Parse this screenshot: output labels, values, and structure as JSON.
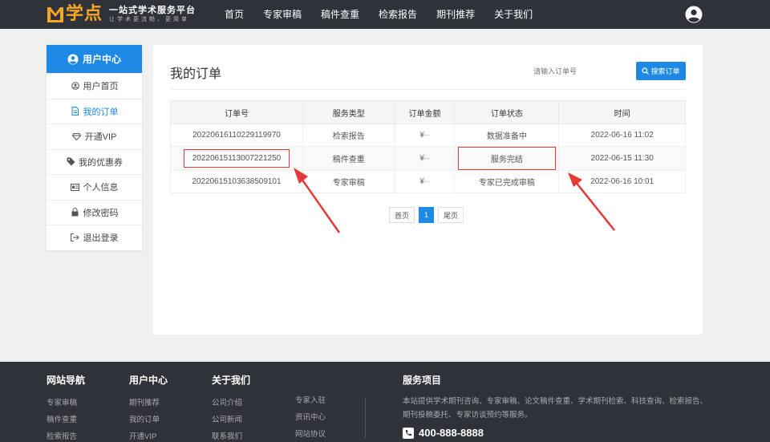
{
  "brand": {
    "logo_text": "学点",
    "tagline": "一站式学术服务平台",
    "tagline_sub": "让学术更流畅、更简单"
  },
  "nav": {
    "items": [
      {
        "label": "首页"
      },
      {
        "label": "专家审稿"
      },
      {
        "label": "稿件查重"
      },
      {
        "label": "检索报告"
      },
      {
        "label": "期刊推荐"
      },
      {
        "label": "关于我们"
      }
    ]
  },
  "sidebar": {
    "header": "用户中心",
    "items": [
      {
        "label": "用户首页",
        "icon": "user-circle-icon"
      },
      {
        "label": "我的订单",
        "icon": "document-icon",
        "active": true
      },
      {
        "label": "开通VIP",
        "icon": "diamond-icon"
      },
      {
        "label": "我的优惠券",
        "icon": "tag-icon"
      },
      {
        "label": "个人信息",
        "icon": "id-card-icon"
      },
      {
        "label": "修改密码",
        "icon": "lock-icon"
      },
      {
        "label": "退出登录",
        "icon": "logout-icon"
      }
    ]
  },
  "main": {
    "title": "我的订单",
    "search_placeholder": "请输入订单号",
    "search_button": "搜索订单",
    "table": {
      "headers": [
        "订单号",
        "服务类型",
        "订单金额",
        "订单状态",
        "时间"
      ],
      "rows": [
        {
          "id": "20220616110229119970",
          "type": "检索报告",
          "amount": "¥··",
          "status": "数据准备中",
          "status_color": "#8e44ad",
          "time": "2022-06-16 11:02"
        },
        {
          "id": "20220615113007221250",
          "type": "稿件查重",
          "amount": "¥··",
          "status": "服务完结",
          "status_color": "#5cb85c",
          "time": "2022-06-15 11:30"
        },
        {
          "id": "20220615103638509101",
          "type": "专家审稿",
          "amount": "¥··",
          "status": "专家已完成审稿",
          "status_color": "#5cb85c",
          "time": "2022-06-16 10:01"
        }
      ]
    },
    "pager": {
      "first": "首页",
      "current": "1",
      "last": "尾页"
    }
  },
  "footer": {
    "col1": {
      "title": "网站导航",
      "links": [
        "专家审稿",
        "稿件查重",
        "检索报告"
      ]
    },
    "col2": {
      "title": "用户中心",
      "links": [
        "期刊推荐",
        "我的订单",
        "开通VIP"
      ]
    },
    "col3": {
      "title": "关于我们",
      "links": [
        "公司介绍",
        "公司新闻",
        "联系我们"
      ]
    },
    "col4": {
      "links": [
        "专家入驻",
        "资讯中心",
        "网站协议"
      ]
    },
    "services": {
      "title": "服务项目",
      "desc": "本站提供学术期刊咨询、专家审稿、论文稿件查重、学术期刊检索、科技查询、检索报告、期刊投稿委托、专家访谈预约等服务。",
      "phone": "400-888-8888"
    }
  },
  "colors": {
    "nav_bg": "#2f3238",
    "accent": "#1e88e5",
    "brand_orange": "#f5a623",
    "highlight_red": "#e53935"
  }
}
